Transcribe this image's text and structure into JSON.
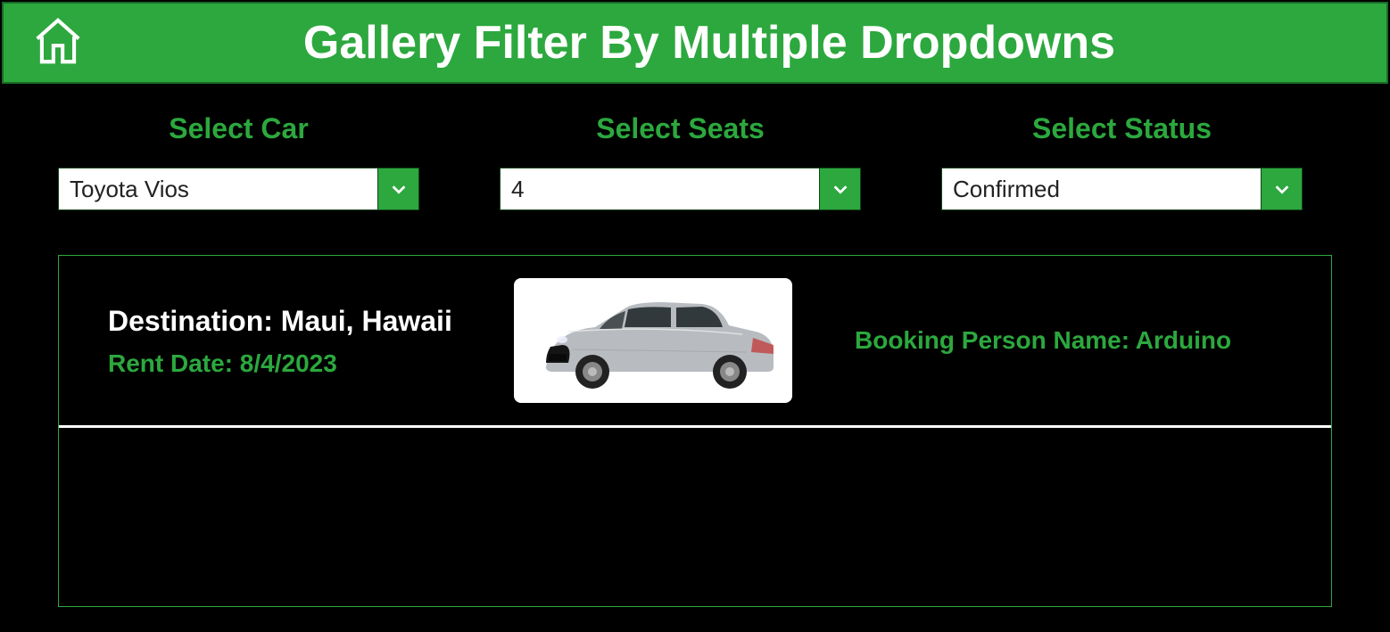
{
  "header": {
    "title": "Gallery Filter By Multiple Dropdowns"
  },
  "filters": {
    "car": {
      "label": "Select Car",
      "value": "Toyota Vios"
    },
    "seats": {
      "label": "Select Seats",
      "value": "4"
    },
    "status": {
      "label": "Select Status",
      "value": "Confirmed"
    }
  },
  "results": [
    {
      "destination": "Destination: Maui, Hawaii",
      "rent_date": "Rent Date: 8/4/2023",
      "booking": "Booking Person Name: Arduino"
    }
  ]
}
